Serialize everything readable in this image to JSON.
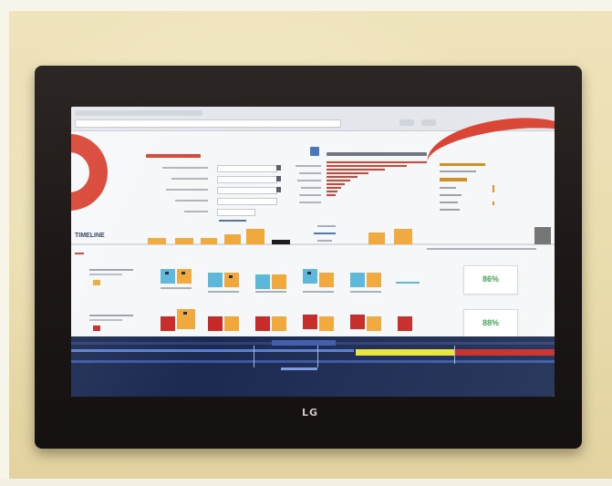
{
  "scene": {
    "description_text": "",
    "brand_logo": "LG"
  },
  "dashboard": {
    "timeline_label": "TIMELINE",
    "row1_percent": "86%",
    "row2_percent": "88%"
  },
  "colors": {
    "accent_red": "#d8402f",
    "accent_orange": "#f0a83a",
    "accent_blue": "#5bb7d9",
    "accent_dark_red": "#c62a26",
    "panel_navy": "#1c2a52",
    "status_green": "#38a54a",
    "status_yellow": "#e8e43a"
  },
  "icons": [
    "tv-logo",
    "red-arc-graphic",
    "bar-chart",
    "status-squares"
  ]
}
